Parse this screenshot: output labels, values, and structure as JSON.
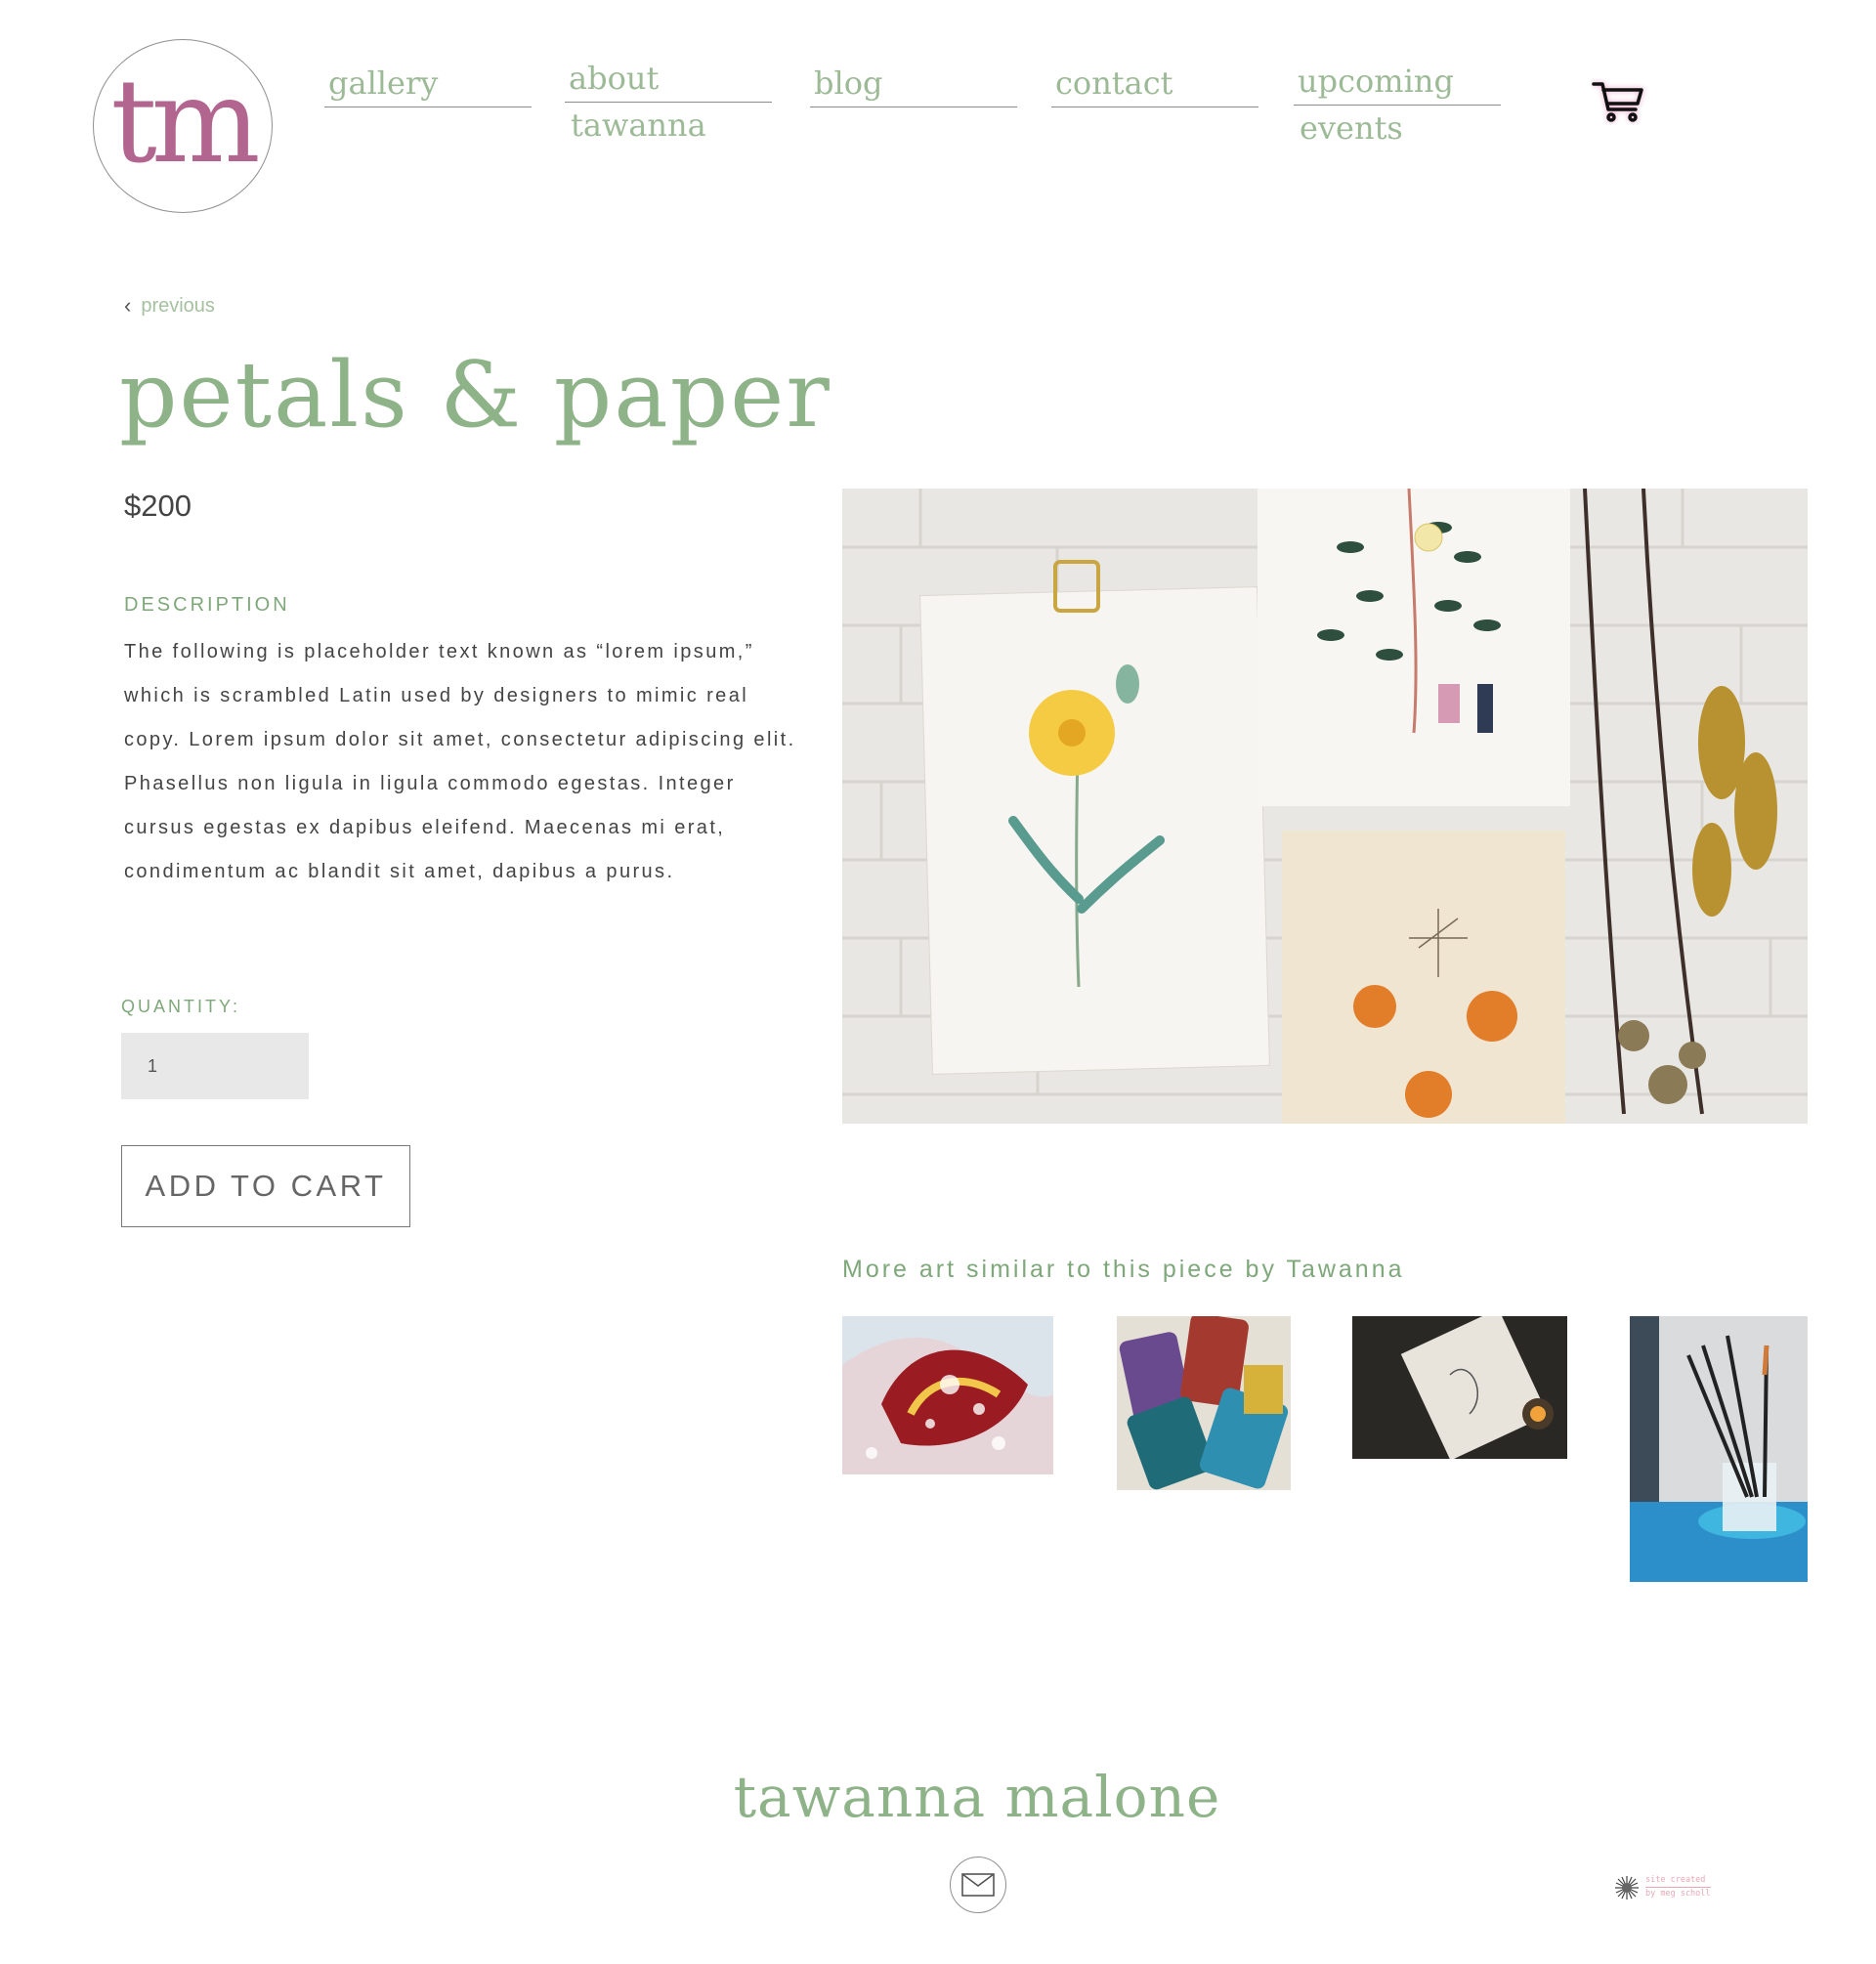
{
  "logo": {
    "text": "tm"
  },
  "nav": {
    "gallery": {
      "line1": "gallery",
      "line2": ""
    },
    "about": {
      "line1": "about",
      "line2": "tawanna"
    },
    "blog": {
      "line1": "blog",
      "line2": ""
    },
    "contact": {
      "line1": "contact",
      "line2": ""
    },
    "upcoming": {
      "line1": "upcoming",
      "line2": "events"
    },
    "cart_icon": "shopping-cart-icon"
  },
  "product": {
    "previous_label": "previous",
    "title": "petals & paper",
    "price": "$200",
    "description_label": "DESCRIPTION",
    "description": "The following is placeholder text known as “lorem ipsum,” which is scrambled Latin used by designers to mimic real copy. Lorem ipsum dolor sit amet, consectetur adipiscing elit. Phasellus non ligula in ligula commodo egestas. Integer cursus egestas ex dapibus eleifend. Maecenas mi erat, condimentum ac blandit sit amet, dapibus a purus.",
    "quantity_label": "QUANTITY:",
    "quantity_value": "1",
    "add_to_cart_label": "ADD TO CART"
  },
  "similar": {
    "title": "More art similar to this piece by Tawanna"
  },
  "footer": {
    "name": "tawanna malone",
    "mail_icon": "envelope-icon",
    "credit_line1": "site created",
    "credit_line2": "by meg scholl"
  },
  "colors": {
    "accent_green": "#8fb389",
    "logo_pink": "#b2668f",
    "text_dark": "#444444"
  }
}
